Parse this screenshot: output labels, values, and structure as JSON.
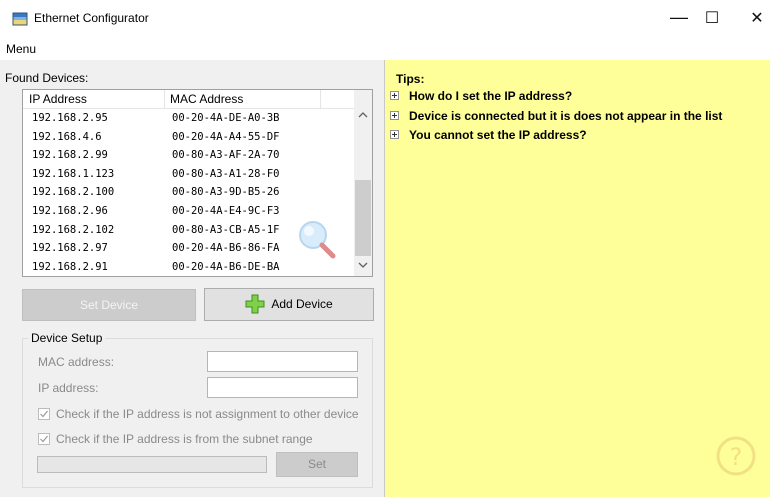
{
  "window": {
    "title": "Ethernet Configurator",
    "min_glyph": "—",
    "max_glyph": "☐",
    "close_glyph": "✕"
  },
  "menu": {
    "label": "Menu"
  },
  "devices": {
    "label": "Found Devices:",
    "columns": [
      "IP Address",
      "MAC Address"
    ],
    "rows": [
      {
        "ip": "192.168.2.95",
        "mac": "00-20-4A-DE-A0-3B"
      },
      {
        "ip": "192.168.4.6",
        "mac": "00-20-4A-A4-55-DF"
      },
      {
        "ip": "192.168.2.99",
        "mac": "00-80-A3-AF-2A-70"
      },
      {
        "ip": "192.168.1.123",
        "mac": "00-80-A3-A1-28-F0"
      },
      {
        "ip": "192.168.2.100",
        "mac": "00-80-A3-9D-B5-26"
      },
      {
        "ip": "192.168.2.96",
        "mac": "00-20-4A-E4-9C-F3"
      },
      {
        "ip": "192.168.2.102",
        "mac": "00-80-A3-CB-A5-1F"
      },
      {
        "ip": "192.168.2.97",
        "mac": "00-20-4A-B6-86-FA"
      },
      {
        "ip": "192.168.2.91",
        "mac": "00-20-4A-B6-DE-BA"
      }
    ]
  },
  "buttons": {
    "set_device": "Set Device",
    "add_device": "Add Device",
    "set": "Set"
  },
  "device_setup": {
    "title": "Device Setup",
    "mac_label": "MAC address:",
    "ip_label": "IP address:",
    "mac_value": "",
    "ip_value": "",
    "check1": "Check if the IP address is not assignment to other device",
    "check2": "Check if the IP address is from the subnet range",
    "check1_checked": true,
    "check2_checked": true
  },
  "tips": {
    "title": "Tips:",
    "items": [
      "How do I set the IP address?",
      "Device is connected but it is does not appear in the list",
      "You cannot set the IP address?"
    ]
  },
  "colors": {
    "tips_bg": "#ffff99",
    "panel_bg": "#f0f0f0"
  }
}
